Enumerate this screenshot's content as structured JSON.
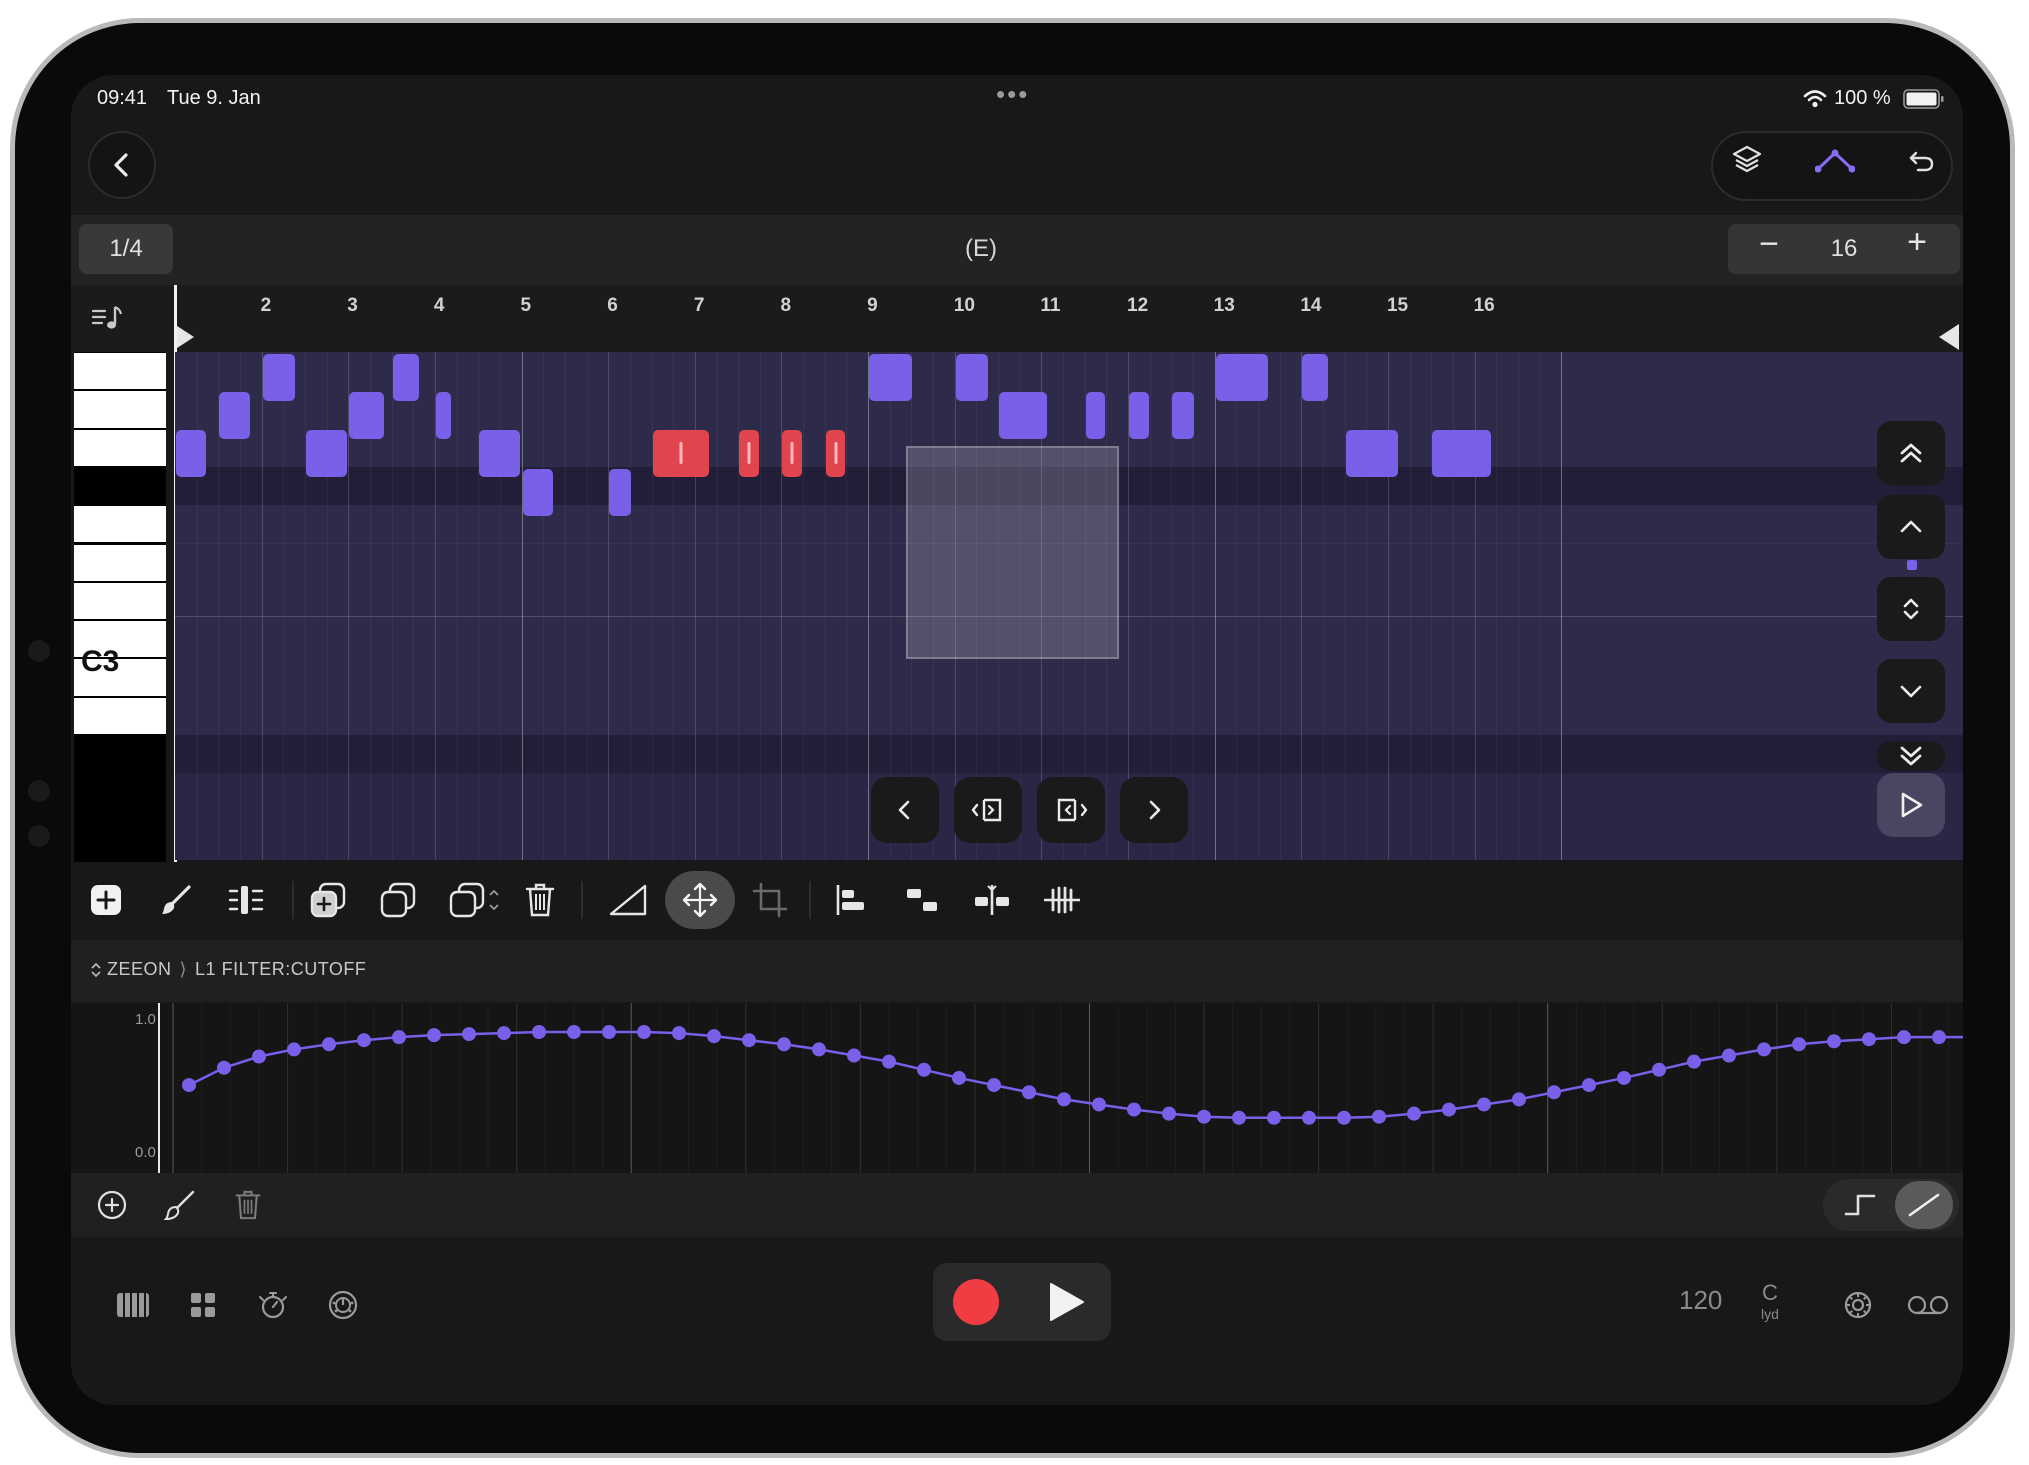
{
  "status_bar": {
    "time": "09:41",
    "date": "Tue 9. Jan",
    "more": "•••",
    "battery": "100 %"
  },
  "header": {
    "quantize": "1/4",
    "clip_name": "(E)",
    "length": "16",
    "minus": "−",
    "plus": "+"
  },
  "ruler": {
    "bars": [
      "2",
      "3",
      "4",
      "5",
      "6",
      "7",
      "8",
      "9",
      "10",
      "11",
      "12",
      "13",
      "14",
      "15",
      "16"
    ]
  },
  "piano": {
    "c_label": "C3"
  },
  "notes": {
    "total_steps": 64,
    "rows": 10,
    "items": [
      {
        "row": 4,
        "start": 0.0,
        "length": 1.4,
        "selected": false
      },
      {
        "row": 3,
        "start": 2.0,
        "length": 1.4,
        "selected": false
      },
      {
        "row": 2,
        "start": 4.0,
        "length": 1.5,
        "selected": false
      },
      {
        "row": 4,
        "start": 6.0,
        "length": 1.9,
        "selected": false
      },
      {
        "row": 3,
        "start": 8.0,
        "length": 1.6,
        "selected": false
      },
      {
        "row": 2,
        "start": 10.0,
        "length": 1.2,
        "selected": false
      },
      {
        "row": 3,
        "start": 12.0,
        "length": 0.7,
        "selected": false
      },
      {
        "row": 4,
        "start": 14.0,
        "length": 1.9,
        "selected": false
      },
      {
        "row": 5,
        "start": 16.0,
        "length": 1.4,
        "selected": false
      },
      {
        "row": 5,
        "start": 20.0,
        "length": 1.0,
        "selected": false
      },
      {
        "row": 4,
        "start": 22.0,
        "length": 2.6,
        "selected": true
      },
      {
        "row": 4,
        "start": 26.0,
        "length": 0.9,
        "selected": true
      },
      {
        "row": 4,
        "start": 28.0,
        "length": 0.9,
        "selected": true
      },
      {
        "row": 4,
        "start": 30.0,
        "length": 0.9,
        "selected": true
      },
      {
        "row": 2,
        "start": 32.0,
        "length": 2.0,
        "selected": false
      },
      {
        "row": 2,
        "start": 36.0,
        "length": 1.5,
        "selected": false
      },
      {
        "row": 3,
        "start": 38.0,
        "length": 2.2,
        "selected": false
      },
      {
        "row": 3,
        "start": 42.0,
        "length": 0.9,
        "selected": false
      },
      {
        "row": 3,
        "start": 44.0,
        "length": 0.9,
        "selected": false
      },
      {
        "row": 3,
        "start": 46.0,
        "length": 1.0,
        "selected": false
      },
      {
        "row": 2,
        "start": 48.0,
        "length": 2.4,
        "selected": false
      },
      {
        "row": 2,
        "start": 52.0,
        "length": 1.2,
        "selected": false
      },
      {
        "row": 4,
        "start": 54.0,
        "length": 2.4,
        "selected": false
      },
      {
        "row": 4,
        "start": 58.0,
        "length": 2.7,
        "selected": false
      }
    ]
  },
  "automation": {
    "device": "ZEEON",
    "parameter": "L1 FILTER:CUTOFF",
    "y_max": "1.0",
    "y_min": "0.0",
    "values": [
      0.45,
      0.62,
      0.73,
      0.8,
      0.85,
      0.89,
      0.92,
      0.94,
      0.95,
      0.96,
      0.97,
      0.97,
      0.97,
      0.97,
      0.96,
      0.93,
      0.89,
      0.85,
      0.8,
      0.74,
      0.68,
      0.6,
      0.52,
      0.45,
      0.38,
      0.31,
      0.26,
      0.21,
      0.17,
      0.14,
      0.13,
      0.13,
      0.13,
      0.13,
      0.14,
      0.17,
      0.21,
      0.26,
      0.31,
      0.38,
      0.45,
      0.52,
      0.6,
      0.68,
      0.74,
      0.8,
      0.85,
      0.88,
      0.9,
      0.92,
      0.92,
      0.92,
      0.91,
      0.91
    ]
  },
  "transport": {
    "tempo": "120",
    "key_root": "C",
    "key_mode": "lyd"
  },
  "colors": {
    "accent": "#7a5fe8",
    "selected_note": "#e0454e",
    "record": "#f23c44",
    "grid_bg": "#2b2546"
  }
}
